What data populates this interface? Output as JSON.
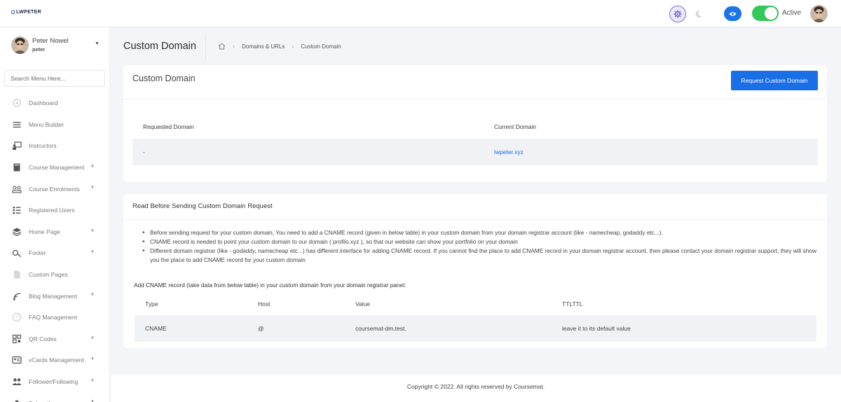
{
  "header": {
    "logo": "LWPETER",
    "toggle_label": "Active"
  },
  "sidebar": {
    "user_name": "Peter Nowel",
    "user_role": "peter",
    "search_placeholder": "Search Menu Here...",
    "items": [
      {
        "label": "Dashboard",
        "icon": "dashboard-icon",
        "dropdown": false
      },
      {
        "label": "Menu Builder",
        "icon": "menu-icon",
        "dropdown": false
      },
      {
        "label": "Instructors",
        "icon": "instructor-icon",
        "dropdown": false
      },
      {
        "label": "Course Management",
        "icon": "book-icon",
        "dropdown": true
      },
      {
        "label": "Course Enrolments",
        "icon": "enrolment-icon",
        "dropdown": true
      },
      {
        "label": "Registered Users",
        "icon": "users-list-icon",
        "dropdown": false
      },
      {
        "label": "Home Page",
        "icon": "layers-icon",
        "dropdown": true
      },
      {
        "label": "Footer",
        "icon": "footer-icon",
        "dropdown": true
      },
      {
        "label": "Custom Pages",
        "icon": "page-icon",
        "dropdown": false
      },
      {
        "label": "Blog Management",
        "icon": "blog-icon",
        "dropdown": true
      },
      {
        "label": "FAQ Management",
        "icon": "question-icon",
        "dropdown": false
      },
      {
        "label": "QR Codes",
        "icon": "qr-icon",
        "dropdown": true
      },
      {
        "label": "vCards Management",
        "icon": "vcard-icon",
        "dropdown": true
      },
      {
        "label": "Follower/Following",
        "icon": "people-icon",
        "dropdown": true
      },
      {
        "label": "Subscribers",
        "icon": "subscribers-icon",
        "dropdown": true
      }
    ]
  },
  "page": {
    "title": "Custom Domain",
    "breadcrumb": [
      "Domains & URLs",
      "Custom Domain"
    ]
  },
  "domain_card": {
    "title": "Custom Domain",
    "request_button": "Request Custom Domain",
    "columns": [
      "Requested Domain",
      "Current Domain"
    ],
    "rows": [
      {
        "requested": "-",
        "current": "lwpeter.xyz"
      }
    ]
  },
  "info_card": {
    "title": "Read Before Sending Custom Domain Request",
    "bullets": [
      "Before sending request for your custom domain, You need to add a CNAME record (given in below table) in your custom domain from your domain registrar account (like - namecheap, godaddy etc...).",
      "CNAME record is needed to point your custom domain to our domain ( profilo.xyz ), so that our website can show your portfolio on your domain",
      "Different domain registrar (like - godaddy, namecheap etc...) has different interface for adding CNAME record. If you cannot find the place to add CNAME record in your domain registrar account, then please contact your domain registrar support, they will show you the place to add CNAME record for your custom domain"
    ],
    "table_note": "Add CNAME record (take data from below table) in your custom domain from your domain registrar panel:",
    "columns": [
      "Type",
      "Host",
      "Value",
      "TTLTTL"
    ],
    "rows": [
      {
        "type": "CNAME",
        "host": "@",
        "value": "coursemat-dm.test.",
        "ttl": "leave it to its default value"
      }
    ]
  },
  "footer": {
    "copyright": "Copyright © 2022. All rights reserved by Coursemat."
  }
}
